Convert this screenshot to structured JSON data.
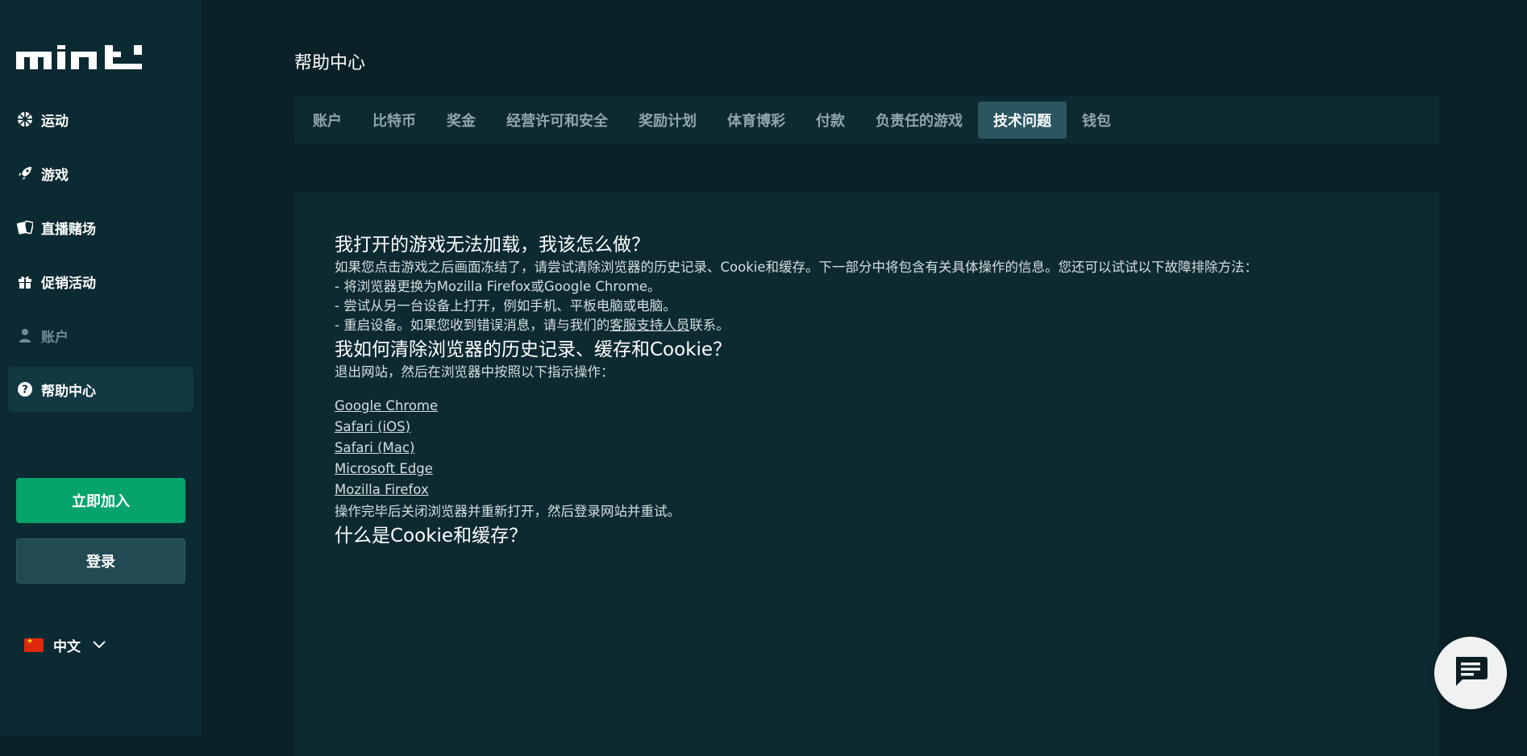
{
  "brand": {
    "logo_text": "mint"
  },
  "sidebar": {
    "items": [
      {
        "label": "运动",
        "icon": "sports-ball-icon"
      },
      {
        "label": "游戏",
        "icon": "rocket-icon"
      },
      {
        "label": "直播赌场",
        "icon": "cards-icon"
      },
      {
        "label": "促销活动",
        "icon": "gift-icon"
      },
      {
        "label": "账户",
        "icon": "user-icon"
      },
      {
        "label": "帮助中心",
        "icon": "help-icon"
      }
    ],
    "join_label": "立即加入",
    "login_label": "登录",
    "language": "中文"
  },
  "main": {
    "title": "帮助中心",
    "tabs": [
      {
        "label": "账户"
      },
      {
        "label": "比特币"
      },
      {
        "label": "奖金"
      },
      {
        "label": "经营许可和安全"
      },
      {
        "label": "奖励计划"
      },
      {
        "label": "体育博彩"
      },
      {
        "label": "付款"
      },
      {
        "label": "负责任的游戏"
      },
      {
        "label": "技术问题",
        "active": true
      },
      {
        "label": "钱包"
      }
    ],
    "sections": [
      {
        "heading": "我打开的游戏无法加载，我该怎么做？",
        "intro": "如果您点击游戏之后画面冻结了，请尝试清除浏览器的历史记录、Cookie和缓存。下一部分中将包含有关具体操作的信息。您还可以试试以下故障排除方法：",
        "bullet1": "- 将浏览器更换为Mozilla Firefox或Google Chrome。",
        "bullet2": "- 尝试从另一台设备上打开，例如手机、平板电脑或电脑。",
        "bullet3_prefix": "- 重启设备。如果您收到错误消息，请与我们的",
        "bullet3_link": "客服支持人员",
        "bullet3_suffix": "联系。"
      },
      {
        "heading": "我如何清除浏览器的历史记录、缓存和Cookie？",
        "intro": "退出网站，然后在浏览器中按照以下指示操作：",
        "links": [
          "Google Chrome",
          "Safari (iOS)",
          "Safari (Mac)",
          "Microsoft Edge",
          "Mozilla Firefox"
        ],
        "outro": "操作完毕后关闭浏览器并重新打开，然后登录网站并重试。"
      },
      {
        "heading": "什么是Cookie和缓存？"
      }
    ]
  },
  "colors": {
    "background": "#0a2127",
    "sidebar": "#0c2a31",
    "accent_green": "#06a36b",
    "active_tab": "#2a5660"
  }
}
